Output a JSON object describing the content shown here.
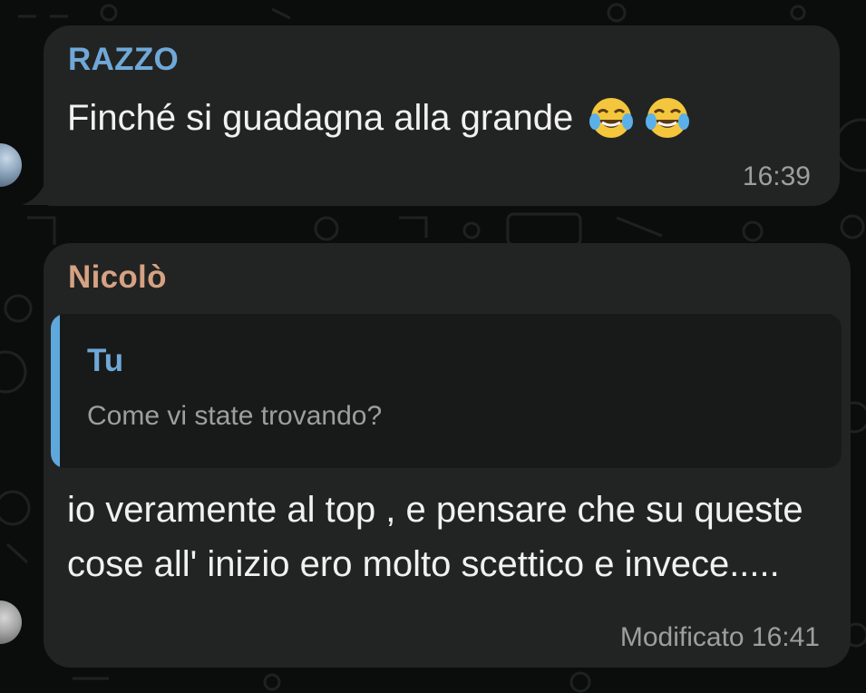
{
  "messages": [
    {
      "sender": "RAZZO",
      "text": "Finché si guadagna alla grande",
      "emojis": [
        "face-with-tears-of-joy-icon",
        "face-with-tears-of-joy-icon"
      ],
      "time": "16:39"
    },
    {
      "sender": "Nicolò",
      "reply": {
        "sender": "Tu",
        "text": "Come vi state trovando?"
      },
      "text": "io veramente al top , e pensare che su queste cose all' inizio ero molto scettico e invece.....",
      "time": "Modificato 16:41"
    }
  ],
  "colors": {
    "background": "#0b0d0c",
    "bubble": "#222423",
    "quote_background": "#181a19",
    "quote_bar": "#5fa8db",
    "sender_razzo": "#6fa8d8",
    "sender_nicolo": "#d5a283",
    "meta_text": "#9aa09e"
  }
}
